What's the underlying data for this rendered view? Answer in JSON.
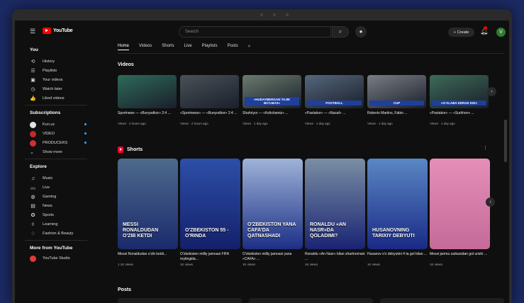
{
  "app": {
    "logo_text": "YouTube"
  },
  "search": {
    "placeholder": "Search"
  },
  "header": {
    "create_label": "Create",
    "avatar_letter": "V"
  },
  "sidebar": {
    "you_heading": "You",
    "you_items": [
      {
        "icon": "history-icon",
        "glyph": "⟲",
        "label": "History"
      },
      {
        "icon": "playlist-icon",
        "glyph": "☰",
        "label": "Playlists"
      },
      {
        "icon": "your-videos-icon",
        "glyph": "▣",
        "label": "Your videos"
      },
      {
        "icon": "watch-later-icon",
        "glyph": "◷",
        "label": "Watch later"
      },
      {
        "icon": "liked-icon",
        "glyph": "👍",
        "label": "Liked videos"
      }
    ],
    "subs_heading": "Subscriptions",
    "subs_items": [
      {
        "label": "Kun.uz",
        "color": "#e0e0e0",
        "dot": true
      },
      {
        "label": "VIDEO",
        "color": "#c62828",
        "dot": true
      },
      {
        "label": "PRODUCERS",
        "color": "#d32f2f",
        "dot": true
      },
      {
        "label": "Show more",
        "color": "",
        "dot": false
      }
    ],
    "explore_heading": "Explore",
    "explore_items": [
      {
        "icon": "music-icon",
        "glyph": "♫",
        "label": "Music"
      },
      {
        "icon": "live-icon",
        "glyph": "((•))",
        "label": "Live"
      },
      {
        "icon": "gaming-icon",
        "glyph": "◍",
        "label": "Gaming"
      },
      {
        "icon": "news-icon",
        "glyph": "▤",
        "label": "News"
      },
      {
        "icon": "sports-icon",
        "glyph": "✪",
        "label": "Sports"
      },
      {
        "icon": "learning-icon",
        "glyph": "◊",
        "label": "Learning"
      },
      {
        "icon": "fashion-icon",
        "glyph": "♢",
        "label": "Fashion & Beauty"
      }
    ],
    "more_heading": "More from YouTube",
    "more_items": [
      {
        "label": "YouTube Studio"
      }
    ]
  },
  "chips": [
    "Home",
    "Videos",
    "Shorts",
    "Live",
    "Playlists",
    "Posts"
  ],
  "videos_section": {
    "title": "Videos",
    "items": [
      {
        "title": "Sportnews — «Bunyodkor» 2:4 ...",
        "meta": "Views · 2 hours ago",
        "bg": "#2e6a5a",
        "caption": ""
      },
      {
        "title": "«Sportnews» — «Bunyodkor» 2:4 ...",
        "meta": "Views · 2 hours ago",
        "bg": "#4a5158",
        "caption": ""
      },
      {
        "title": "Shahriyor — «Kelishamiz» ...",
        "meta": "Views · 1 day ago",
        "bg": "#6a7b6f",
        "caption": "«HUDAYBERGAN TAJIK BO'LMAS»"
      },
      {
        "title": "«Paxtakor» — «Nasaf» ...",
        "meta": "Views · 1 day ago",
        "bg": "#55677d",
        "caption": "FOOTBALL"
      },
      {
        "title": "Roberto Martins, Fabio ...",
        "meta": "Views · 1 day ago",
        "bg": "#7a7f86",
        "caption": "CUP"
      },
      {
        "title": "«Paxtakor» — «Surkhon» ...",
        "meta": "Views · 1 day ago",
        "bg": "#3d6b58",
        "caption": "«G'ALABA KERAK EDI»"
      }
    ]
  },
  "shorts_section": {
    "title": "Shorts",
    "items": [
      {
        "caption": "Messi Ronaldudan o'zib ketdi",
        "title": "Messi Ronaldudan o'zib ketdi...",
        "meta": "1.1K views",
        "bg1": "#4d6a8c",
        "bg2": "#1a2a6c"
      },
      {
        "caption": "O'zbekiston 55 - o'rinda",
        "title": "O'zbekiston milliy jamoasi FIFA reytingida...",
        "meta": "1K views",
        "bg1": "#2d4fa8",
        "bg2": "#14206b"
      },
      {
        "caption": "O'zbekiston yana CAFA'da qatnashadi",
        "title": "O'zbekiston milliy jamoasi yana «CAFA» ...",
        "meta": "1K views",
        "bg1": "#9fb3d8",
        "bg2": "#1c2f86"
      },
      {
        "caption": "Ronaldu «An Nasr»da qoladimi?",
        "title": "Ronaldu «An Nasr» bilan shartnomani ...",
        "meta": "1K views",
        "bg1": "#7a8ea3",
        "bg2": "#1a2474"
      },
      {
        "caption": "Husanovning tarixiy debyuti",
        "title": "Husanov o'z debyutini 4 ta gol bilan ...",
        "meta": "1K views",
        "bg1": "#5a87c4",
        "bg2": "#1a2a86"
      },
      {
        "caption": "",
        "title": "Messi jarima zarbasidan gol urishi ...",
        "meta": "1K views",
        "bg1": "#e58fb8",
        "bg2": "#c56a99"
      }
    ]
  },
  "posts_section": {
    "title": "Posts"
  }
}
